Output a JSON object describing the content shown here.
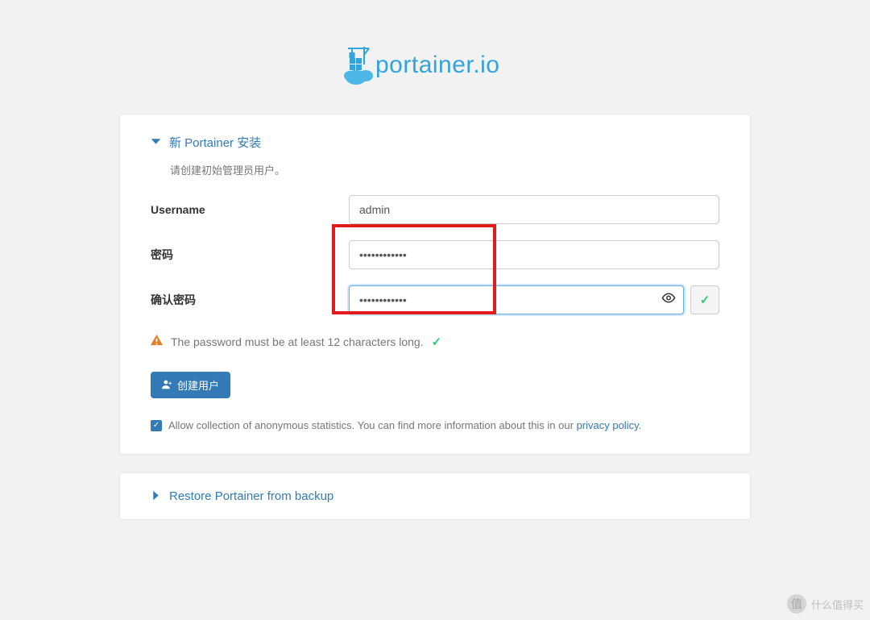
{
  "brand": {
    "name": "portainer.io"
  },
  "install": {
    "heading_prefix": "新 ",
    "heading_brand": "Portainer",
    "heading_suffix": " 安装",
    "subtext": "请创建初始管理员用户。",
    "labels": {
      "username": "Username",
      "password": "密码",
      "confirm_password": "确认密码"
    },
    "values": {
      "username": "admin",
      "password": "••••••••••••",
      "confirm_password": "••••••••••••"
    },
    "hint": "The password must be at least 12 characters long.",
    "create_button": "创建用户",
    "stats_text": "Allow collection of anonymous statistics. You can find more information about this in our ",
    "stats_link": "privacy policy",
    "stats_checked": true
  },
  "restore": {
    "heading": "Restore Portainer from backup"
  },
  "watermark": "什么值得买"
}
